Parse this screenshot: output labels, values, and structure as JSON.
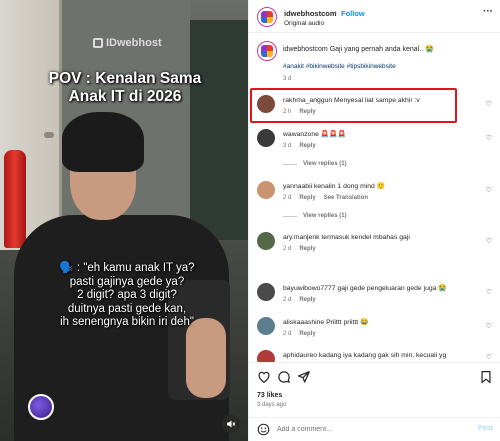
{
  "media": {
    "logo_text": "IDwebhost",
    "title_line1": "POV : Kenalan Sama",
    "title_line2": "Anak IT di 2026",
    "caption_lines": [
      "\"eh kamu anak IT ya?",
      "pasti gajinya gede ya?",
      "2 digit? apa 3 digit?",
      "duitnya pasti gede kan,",
      "ih senengnya bikin iri deh\""
    ],
    "caption_emoji": "🗣️",
    "mute_icon": "speaker-muted-icon"
  },
  "header": {
    "username": "idwebhostcom",
    "separator": "•",
    "follow_label": "Follow",
    "audio_label": "Original audio",
    "more_label": "···"
  },
  "caption": {
    "username": "idwebhostcom",
    "text": "Gaji yang pernah anda kenal.. 😭",
    "hashtags": "#anakit #bikinwebsite #tipsbikinwebsite",
    "time": "3 d"
  },
  "comments": [
    {
      "username": "rakhma_anggun",
      "text": "Menyesal liat sampe akhir :v",
      "time": "2 h",
      "reply": "Reply",
      "color": "#7b4a3a",
      "highlighted": true
    },
    {
      "username": "wawanzone",
      "text": "🚨🚨🚨",
      "time": "3 d",
      "reply": "Reply",
      "view_replies": "View replies (1)",
      "color": "#3a3a3a"
    },
    {
      "username": "yannaabii",
      "text": "kenalin 1 dong mind 🙂",
      "time": "2 d",
      "reply": "Reply",
      "see_translation": "See Translation",
      "view_replies": "View replies (1)",
      "color": "#c9946f"
    },
    {
      "username": "ary.manjenk",
      "text": "termasuk kendel mbahas gaji",
      "time": "2 d",
      "reply": "Reply",
      "color": "#56684a"
    },
    {
      "username": "bayuwibowo7777",
      "text": "gaji gede pengeluaran gede juga 😭",
      "time": "2 d",
      "reply": "Reply",
      "color": "#4a4a4a"
    },
    {
      "username": "aliskaaashine",
      "text": "Priittt priittt 😂",
      "time": "2 d",
      "reply": "Reply",
      "color": "#5c7f8e"
    },
    {
      "username": "aphidaureo",
      "text": "kadang iya kadang gak sih min, kecuali yg",
      "time": "",
      "reply": "",
      "color": "#b03a3a"
    }
  ],
  "footer": {
    "likes": "73 likes",
    "post_time": "3 days ago",
    "comment_placeholder": "Add a comment…",
    "post_label": "Post"
  },
  "colors": {
    "accent_blue": "#0095f6",
    "highlight_red": "#e0141e",
    "meta_gray": "#737373"
  }
}
